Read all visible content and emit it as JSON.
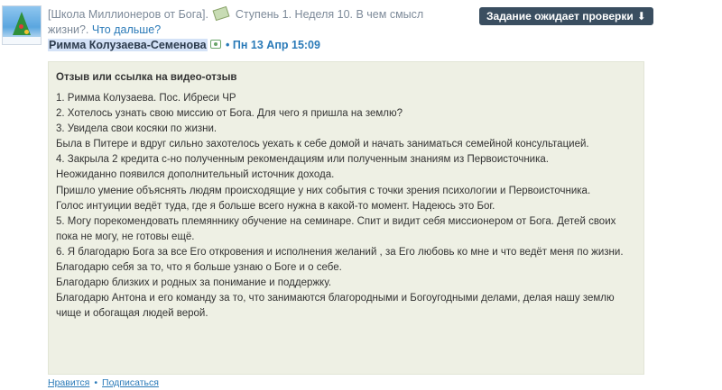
{
  "header": {
    "school": "[Школа Миллионеров от Бога].",
    "money_icon": "money-icon",
    "step": "Ступень 1. Неделя 10. В чем смысл жизни?.",
    "next_link": "Что дальше?"
  },
  "status_button": {
    "label": "Задание ожидает проверки",
    "arrow": "⬇"
  },
  "post": {
    "author": "Римма Колузаева-Семенова",
    "separator": "•",
    "date": "Пн 13 Апр 15:09"
  },
  "panel": {
    "title": "Отзыв или ссылка на видео-отзыв",
    "lines": [
      "1. Римма Колузаева. Пос. Ибреси ЧР",
      "2. Хотелось узнать свою миссию от Бога. Для чего я пришла на землю?",
      "3. Увидела свои косяки по жизни.",
      "Была в Питере и вдруг сильно захотелось уехать к себе домой и начать заниматься семейной консультацией.",
      "4. Закрыла 2 кредита с-но полученным рекомендациям или полученным знаниям из Первоисточника.",
      "Неожиданно появился дополнительный источник дохода.",
      "Пришло умение объяснять людям происходящие у них события с точки зрения психологии и Первоисточника.",
      "Голос интуиции ведёт туда, где я больше всего нужна в какой-то момент. Надеюсь это Бог.",
      "5. Могу порекомендовать племяннику обучение на семинаре. Спит и видит себя миссионером от Бога. Детей своих пока не могу, не готовы ещё.",
      "6. Я благодарю Бога за все Его откровения и исполнения желаний , за Его любовь ко мне и что ведёт меня по жизни.",
      "Благодарю себя за то, что я больше узнаю о Боге и о себе.",
      "Благодарю близких и родных за понимание и поддержку.",
      "Благодарю Антона и его команду за то, что занимаются благородными и Богоугодными делами, делая нашу землю чище и обогащая людей верой."
    ]
  },
  "footer": {
    "like": "Нравится",
    "separator": "•",
    "subscribe": "Подписаться"
  },
  "colors": {
    "panel_bg": "#eef0e4",
    "link": "#2a7ab8",
    "button_bg": "#3a4e60"
  }
}
